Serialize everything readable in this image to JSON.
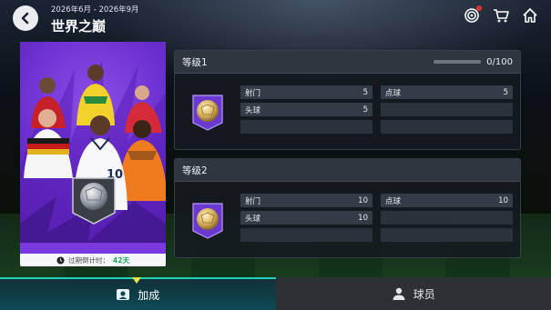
{
  "header": {
    "season": "2026年6月 - 2026年9月",
    "title": "世界之巅"
  },
  "icons": {
    "back": "chevron-left-icon",
    "target": "target-icon",
    "cart": "cart-icon",
    "home": "home-icon"
  },
  "card": {
    "shirt_number": "10",
    "countdown_label": "过期倒计时：",
    "countdown_value": "42天"
  },
  "levels": [
    {
      "title": "等级1",
      "progress_text": "0/100",
      "progress_fraction": 0,
      "stats": [
        {
          "label": "射门",
          "value": "5"
        },
        {
          "label": "点球",
          "value": "5"
        },
        {
          "label": "头球",
          "value": "5"
        }
      ]
    },
    {
      "title": "等级2",
      "stats": [
        {
          "label": "射门",
          "value": "10"
        },
        {
          "label": "点球",
          "value": "10"
        },
        {
          "label": "头球",
          "value": "10"
        }
      ]
    }
  ],
  "tabs": [
    {
      "label": "加成",
      "active": true
    },
    {
      "label": "球员",
      "active": false
    }
  ],
  "colors": {
    "accent": "#22d3b8",
    "countdown": "#1ea55a",
    "card_purple": "#6a2fcf",
    "notification": "#e03232"
  }
}
